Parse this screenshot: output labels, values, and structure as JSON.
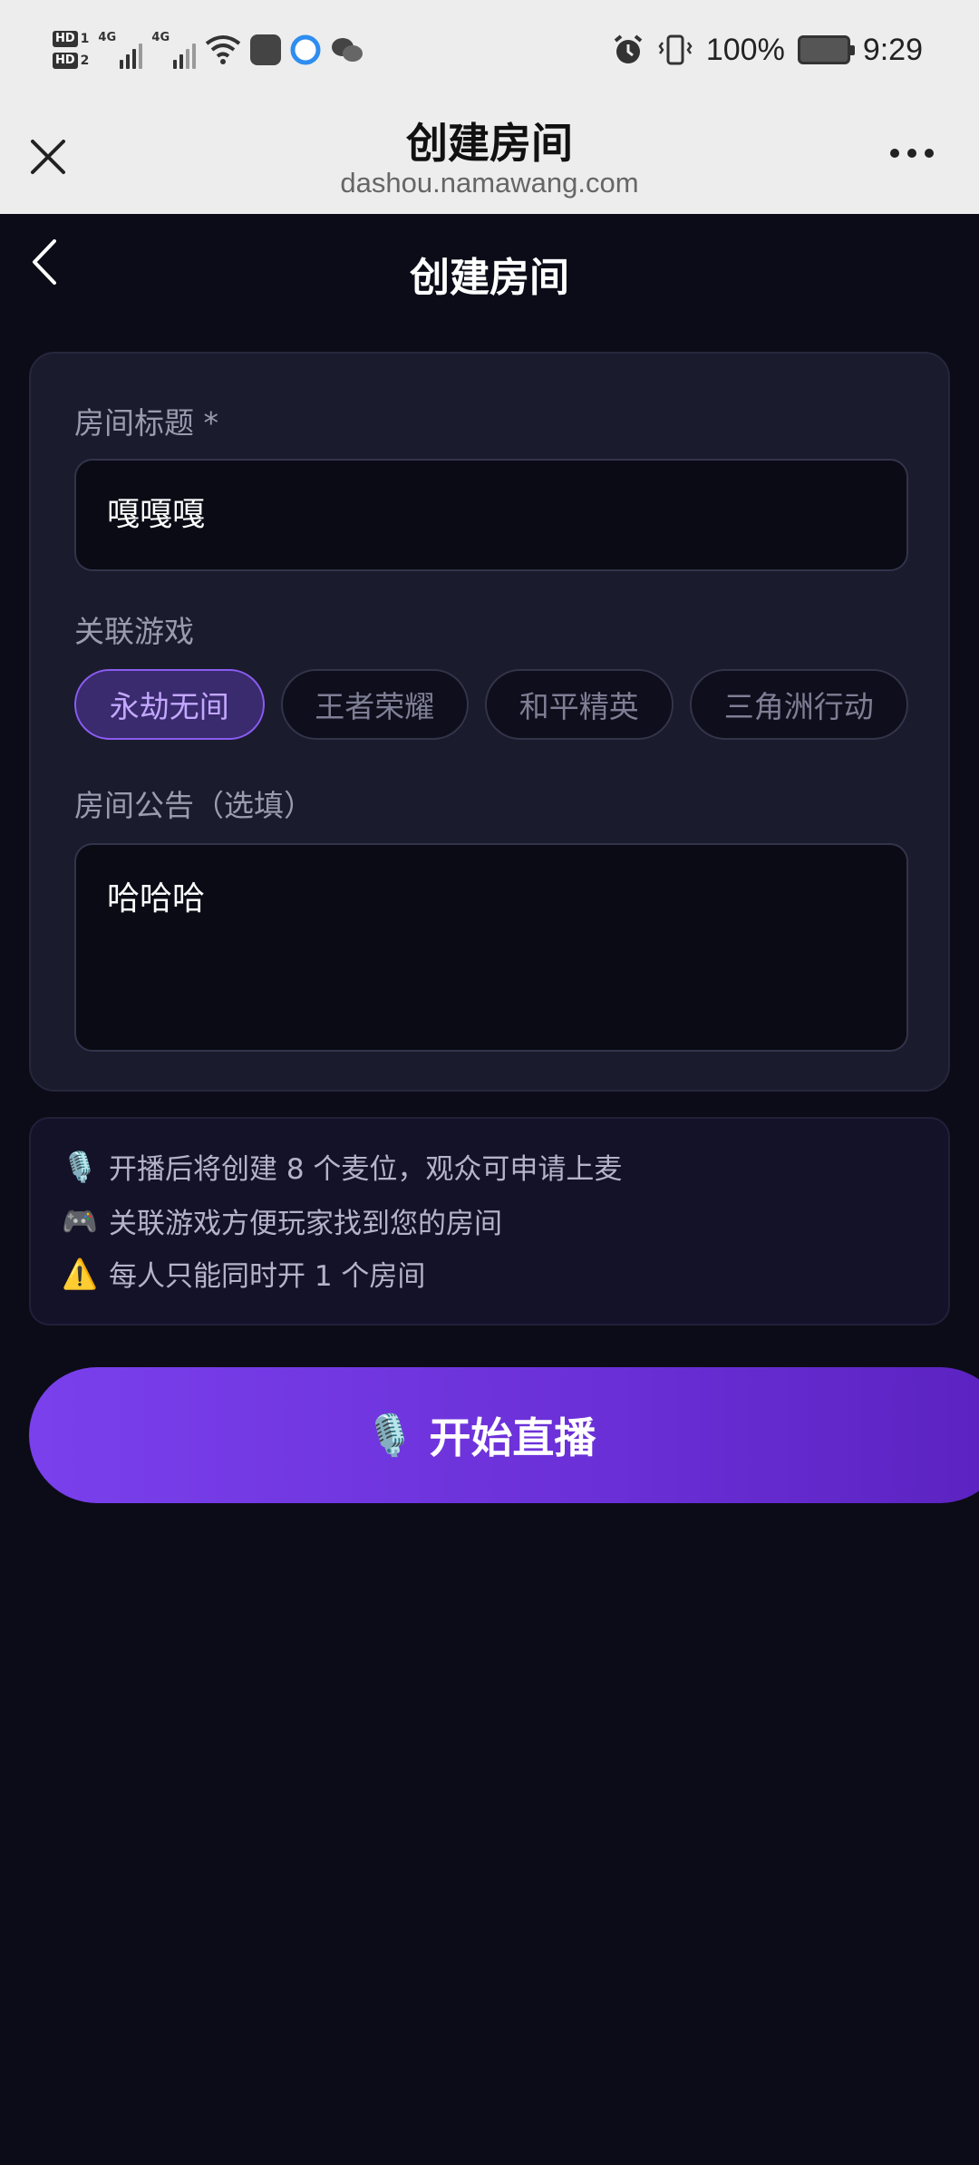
{
  "status_bar": {
    "hd1": "HD",
    "hd1_num": "1",
    "hd2": "HD",
    "hd2_num": "2",
    "net1": "4G",
    "net2": "4G",
    "battery_percent": "100%",
    "time": "9:29"
  },
  "webview": {
    "title": "创建房间",
    "url": "dashou.namawang.com"
  },
  "page": {
    "title": "创建房间"
  },
  "form": {
    "title_label": "房间标题 *",
    "title_value": "嘎嘎嘎",
    "game_label": "关联游戏",
    "games": [
      {
        "label": "永劫无间",
        "selected": true
      },
      {
        "label": "王者荣耀",
        "selected": false
      },
      {
        "label": "和平精英",
        "selected": false
      },
      {
        "label": "三角洲行动",
        "selected": false
      }
    ],
    "notice_label": "房间公告（选填）",
    "notice_value": "哈哈哈"
  },
  "tips": [
    {
      "icon": "microphone-icon",
      "emoji": "🎙️",
      "text": "开播后将创建 8 个麦位，观众可申请上麦"
    },
    {
      "icon": "gamepad-icon",
      "emoji": "🎮",
      "text": "关联游戏方便玩家找到您的房间"
    },
    {
      "icon": "warning-icon",
      "emoji": "⚠️",
      "text": "每人只能同时开 1 个房间"
    }
  ],
  "start_button": {
    "emoji": "🎙️",
    "label": "开始直播"
  },
  "colors": {
    "accent": "#7a40ec",
    "page_bg": "#0c0c18",
    "card_bg": "#1b1b2e",
    "chip_active": "#8a5cf0"
  }
}
